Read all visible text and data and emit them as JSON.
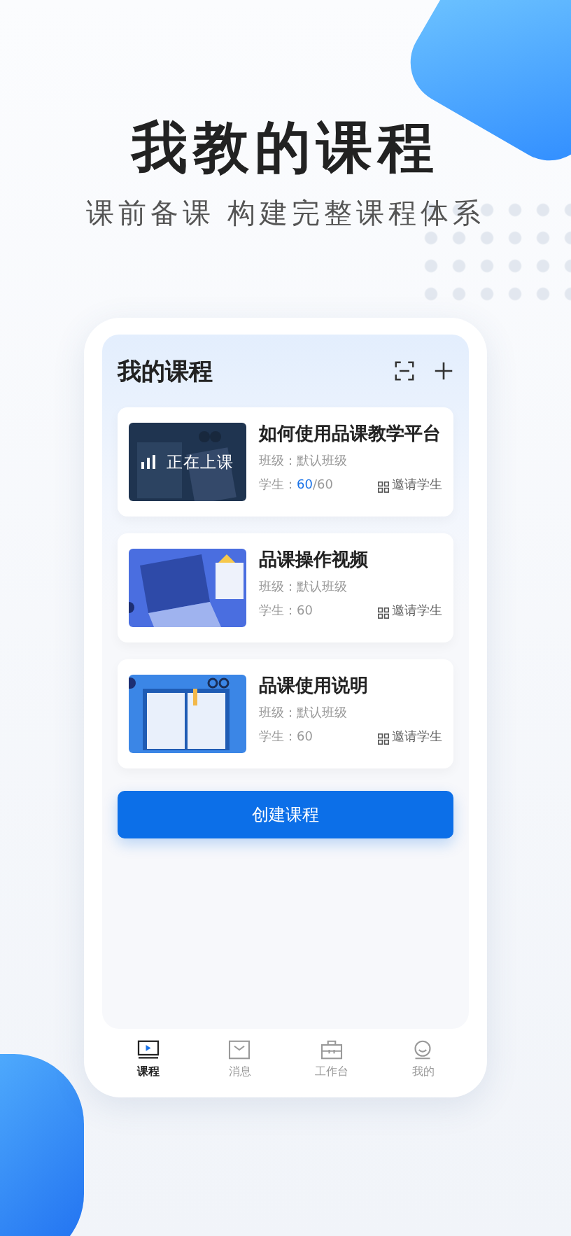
{
  "headline": "我教的课程",
  "subheadline": "课前备课 构建完整课程体系",
  "screen": {
    "title": "我的课程",
    "courses": [
      {
        "kind": "desk",
        "status": "正在上课",
        "title": "如何使用品课教学平台",
        "class_label": "班级：",
        "class_name": "默认班级",
        "students_label": "学生：",
        "students_count": "60",
        "students_total": "/60",
        "invite": "邀请学生"
      },
      {
        "kind": "laptop",
        "title": "品课操作视频",
        "class_label": "班级：",
        "class_name": "默认班级",
        "students_label": "学生：",
        "students_count": "60",
        "invite": "邀请学生"
      },
      {
        "kind": "book",
        "title": "品课使用说明",
        "class_label": "班级：",
        "class_name": "默认班级",
        "students_label": "学生：",
        "students_count": "60",
        "invite": "邀请学生"
      }
    ],
    "create_button": "创建课程"
  },
  "tab_bar": [
    {
      "kind": "course",
      "label": "课程",
      "selected": true
    },
    {
      "kind": "message",
      "label": "消息",
      "selected": false
    },
    {
      "kind": "workbench",
      "label": "工作台",
      "selected": false
    },
    {
      "kind": "me",
      "label": "我的",
      "selected": false
    }
  ]
}
